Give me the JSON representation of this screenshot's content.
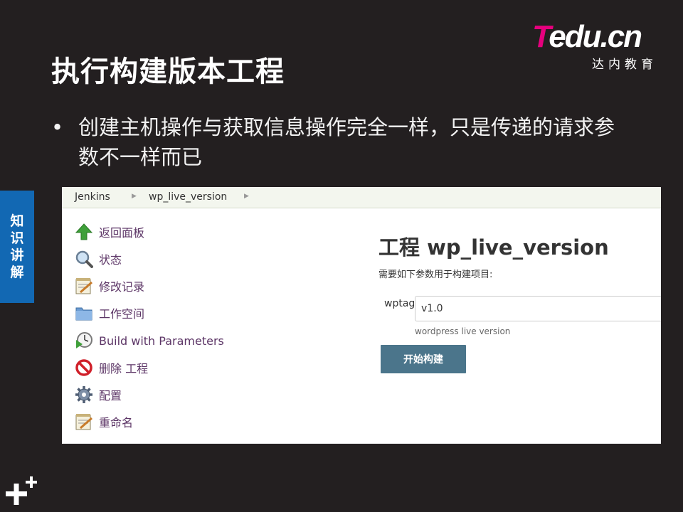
{
  "slide": {
    "title": "执行构建版本工程",
    "bullet_marker": "•",
    "bullet_text": "创建主机操作与获取信息操作完全一样，只是传递的请求参数不一样而已",
    "side_tab": [
      "知",
      "识",
      "讲",
      "解"
    ]
  },
  "logo": {
    "brand_t": "T",
    "brand_rest": "edu.cn",
    "subtitle": "达内教育"
  },
  "jenkins": {
    "breadcrumbs": [
      "Jenkins",
      "wp_live_version"
    ],
    "tasks": [
      {
        "label": "返回面板",
        "icon": "up-arrow-icon"
      },
      {
        "label": "状态",
        "icon": "magnifier-icon"
      },
      {
        "label": "修改记录",
        "icon": "notepad-icon"
      },
      {
        "label": "工作空间",
        "icon": "folder-icon"
      },
      {
        "label": "Build with Parameters",
        "icon": "clock-play-icon"
      },
      {
        "label": "删除 工程",
        "icon": "no-entry-icon"
      },
      {
        "label": "配置",
        "icon": "gear-icon"
      },
      {
        "label": "重命名",
        "icon": "notepad-icon"
      }
    ],
    "heading": "工程 wp_live_version",
    "param_intro": "需要如下参数用于构建项目:",
    "parameter": {
      "name": "wptag",
      "value": "v1.0",
      "description": "wordpress live version"
    },
    "build_button": "开始构建"
  },
  "colors": {
    "background": "#231f20",
    "accent_pink": "#e6007e",
    "side_tab_blue": "#1268b3",
    "jenkins_button": "#4b758b",
    "task_link": "#5c3566"
  }
}
